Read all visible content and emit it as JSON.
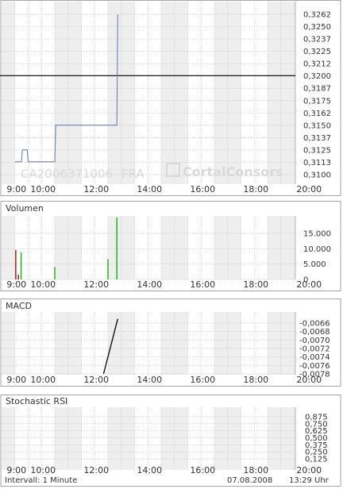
{
  "chart_data": [
    {
      "type": "line",
      "title": "",
      "x_labels": [
        "9:00",
        "10:00",
        "12:00",
        "14:00",
        "16:00",
        "18:00",
        "20:00"
      ],
      "y_ticks": [
        "0,3262",
        "0,3250",
        "0,3237",
        "0,3225",
        "0,3212",
        "0,3200",
        "0,3187",
        "0,3175",
        "0,3162",
        "0,3150",
        "0,3137",
        "0,3125",
        "0,3113",
        "0,3100"
      ],
      "ylim": [
        0.31,
        0.3262
      ],
      "reference_line": 0.32,
      "series": [
        {
          "x": [
            "09:00",
            "09:15",
            "09:17",
            "09:28",
            "09:30",
            "10:30",
            "10:32",
            "12:50",
            "12:52"
          ],
          "y": [
            0.3113,
            0.3113,
            0.3125,
            0.3125,
            0.3113,
            0.3113,
            0.315,
            0.315,
            0.3262
          ]
        }
      ],
      "watermark": {
        "isin": "CA2006371006",
        "exchange": "FRA",
        "brand": "CortalConsors"
      },
      "grid": true
    },
    {
      "type": "bar",
      "title": "Volumen",
      "x_labels": [
        "9:00",
        "10:00",
        "12:00",
        "14:00",
        "16:00",
        "18:00",
        "20:00"
      ],
      "y_ticks": [
        "15.000",
        "10.000",
        "5.000",
        "0"
      ],
      "ylim": [
        0,
        20000
      ],
      "bars": [
        {
          "x": "09:02",
          "value": 9500,
          "color": "#990000"
        },
        {
          "x": "09:08",
          "value": 1500,
          "color": "#990000"
        },
        {
          "x": "09:14",
          "value": 8800,
          "color": "#00aa00"
        },
        {
          "x": "10:30",
          "value": 4000,
          "color": "#00aa00"
        },
        {
          "x": "12:30",
          "value": 6500,
          "color": "#00aa00"
        },
        {
          "x": "12:50",
          "value": 20000,
          "color": "#00aa00"
        }
      ],
      "grid": true
    },
    {
      "type": "line",
      "title": "MACD",
      "x_labels": [
        "9:00",
        "10:00",
        "12:00",
        "14:00",
        "16:00",
        "18:00",
        "20:00"
      ],
      "y_ticks": [
        "-0,0066",
        "-0,0068",
        "-0,0070",
        "-0,0072",
        "-0,0074",
        "-0,0076",
        "-0,0078"
      ],
      "ylim": [
        -0.0079,
        -0.0065
      ],
      "series": [
        {
          "x": [
            "12:20",
            "12:52"
          ],
          "y": [
            -0.0078,
            -0.0065
          ]
        }
      ],
      "grid": true
    },
    {
      "type": "line",
      "title": "Stochastic RSI",
      "x_labels": [
        "9:00",
        "10:00",
        "12:00",
        "14:00",
        "16:00",
        "18:00",
        "20:00"
      ],
      "y_ticks": [
        "0,875",
        "0,750",
        "0,625",
        "0,500",
        "0,375",
        "0,250",
        "0,125"
      ],
      "ylim": [
        0.05,
        0.93
      ],
      "series": [],
      "grid": true
    }
  ],
  "footer": {
    "interval": "Intervall: 1 Minute",
    "date": "07.08.2008",
    "time": "13:29 Uhr"
  },
  "colors": {
    "price_line": "#6a82b5",
    "ref_line": "#000000",
    "shade": "#eeeeee",
    "grid": "#c8c8c8",
    "frame": "#a6a6a6",
    "macd_line": "#000000"
  }
}
